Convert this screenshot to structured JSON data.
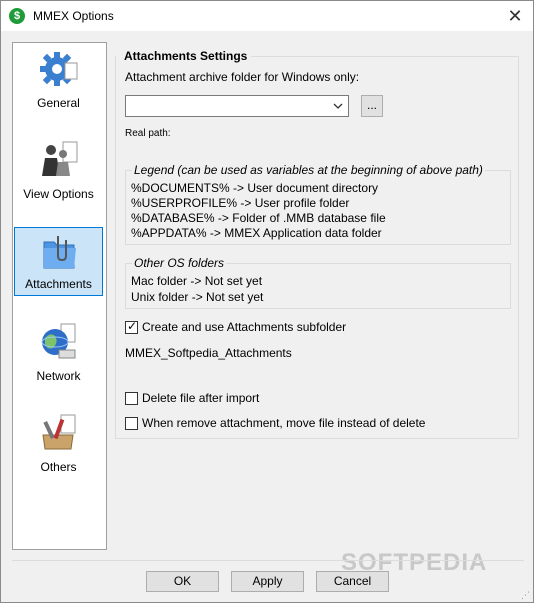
{
  "window": {
    "title": "MMEX Options",
    "app_icon": "$",
    "close": "✕"
  },
  "nav": {
    "items": [
      {
        "label": "General",
        "icon": "gear-icon"
      },
      {
        "label": "View Options",
        "icon": "people-icon"
      },
      {
        "label": "Attachments",
        "icon": "paperclip-folder-icon",
        "selected": true
      },
      {
        "label": "Network",
        "icon": "globe-network-icon"
      },
      {
        "label": "Others",
        "icon": "tools-icon"
      }
    ]
  },
  "attachments": {
    "section_title": "Attachments Settings",
    "archive_folder_label": "Attachment archive folder for Windows only:",
    "folder_value": "",
    "browse_label": "...",
    "real_path_label": "Real path:",
    "legend": {
      "title": "Legend (can be used as variables at the beginning of above path)",
      "lines": [
        "%DOCUMENTS% -> User document directory",
        "%USERPROFILE% -> User profile folder",
        "%DATABASE% -> Folder of .MMB database file",
        "%APPDATA% -> MMEX Application data folder"
      ]
    },
    "other_os": {
      "title": "Other OS folders",
      "lines": [
        "Mac folder -> Not set yet",
        "Unix folder -> Not set yet"
      ]
    },
    "create_subfolder": {
      "label": "Create and use Attachments subfolder",
      "checked": true
    },
    "subfolder_name": "MMEX_Softpedia_Attachments",
    "delete_after_import": {
      "label": "Delete file after import",
      "checked": false
    },
    "move_instead_delete": {
      "label": "When remove attachment, move file instead of delete",
      "checked": false
    }
  },
  "buttons": {
    "ok": "OK",
    "apply": "Apply",
    "cancel": "Cancel"
  },
  "watermark": "SOFTPEDIA",
  "colors": {
    "selected_bg": "#cce4f7",
    "selected_border": "#0078d7",
    "app_icon": "#1f9b3a"
  }
}
